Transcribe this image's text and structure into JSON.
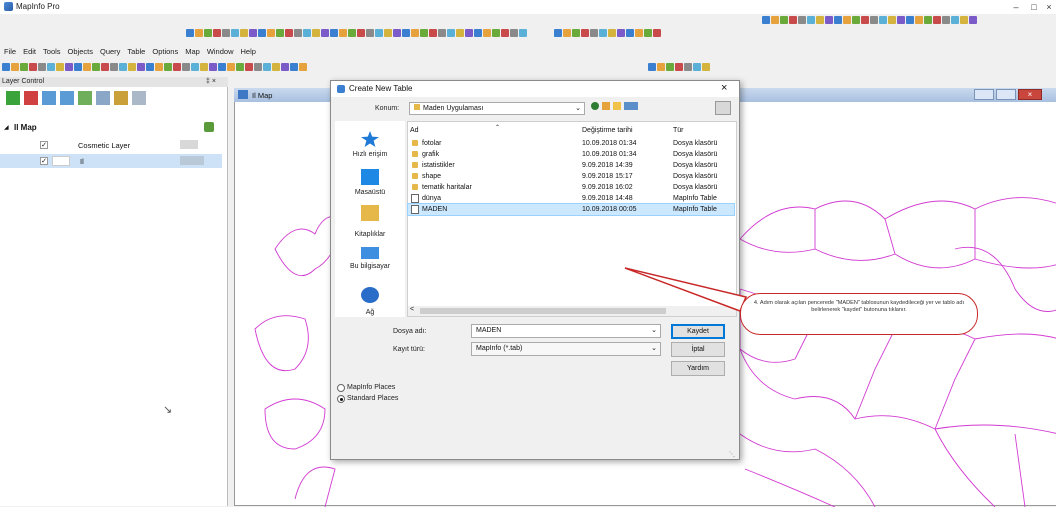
{
  "app": {
    "title": "MapInfo Pro"
  },
  "menu": [
    "File",
    "Edit",
    "Tools",
    "Objects",
    "Query",
    "Table",
    "Options",
    "Map",
    "Window",
    "Help"
  ],
  "layer_control": {
    "title": "Layer Control",
    "pin_close": "‡ ×",
    "map_name": "Il Map",
    "layers": [
      {
        "name": "Cosmetic Layer",
        "checked": true
      },
      {
        "name": "Il",
        "checked": true
      }
    ]
  },
  "map_window": {
    "title": "Il Map"
  },
  "dialog": {
    "title": "Create New Table",
    "close": "×",
    "location_label": "Konum:",
    "location_value": "Maden Uygulaması",
    "places": [
      "Hızlı erişim",
      "Masaüstü",
      "Kitaplıklar",
      "Bu bilgisayar",
      "Ağ"
    ],
    "columns": [
      "Ad",
      "Değiştirme tarihi",
      "Tür"
    ],
    "files": [
      {
        "name": "fotolar",
        "date": "10.09.2018 01:34",
        "type": "Dosya klasörü",
        "kind": "folder"
      },
      {
        "name": "grafik",
        "date": "10.09.2018 01:34",
        "type": "Dosya klasörü",
        "kind": "folder"
      },
      {
        "name": "istatistikler",
        "date": "9.09.2018 14:39",
        "type": "Dosya klasörü",
        "kind": "folder"
      },
      {
        "name": "shape",
        "date": "9.09.2018 15:17",
        "type": "Dosya klasörü",
        "kind": "folder"
      },
      {
        "name": "tematik haritalar",
        "date": "9.09.2018 16:02",
        "type": "Dosya klasörü",
        "kind": "folder"
      },
      {
        "name": "dünya",
        "date": "9.09.2018 14:48",
        "type": "MapInfo Table",
        "kind": "table"
      },
      {
        "name": "MADEN",
        "date": "10.09.2018 00:05",
        "type": "MapInfo Table",
        "kind": "table",
        "selected": true
      }
    ],
    "filename_label": "Dosya adı:",
    "filename_value": "MADEN",
    "filetype_label": "Kayıt türü:",
    "filetype_value": "MapInfo (*.tab)",
    "save_button": "Kaydet",
    "cancel_button": "İptal",
    "help_button": "Yardım",
    "radio_mapinfo": "MapInfo Places",
    "radio_standard": "Standard Places",
    "radio_selected": "standard"
  },
  "callout": {
    "text": "4. Adım olarak açılan pencerede \"MADEN\" tablosunun kaydedileceği yer ve tablo adı belirlenerek \"kaydet\" butonuna tıklanır."
  },
  "colors": {
    "accent": "#0078d7",
    "callout_border": "#c82828",
    "map_border": "#d23ad2",
    "selection": "#cce8ff"
  }
}
